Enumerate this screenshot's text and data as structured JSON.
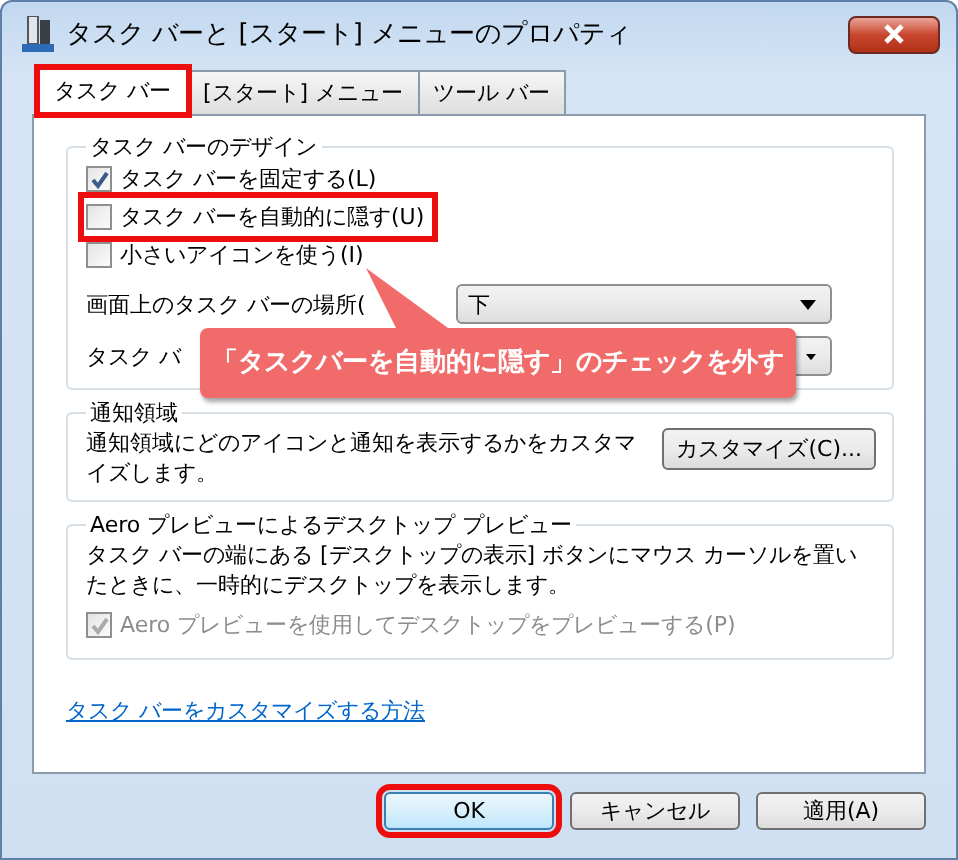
{
  "window": {
    "title": "タスク バーと [スタート] メニューのプロパティ"
  },
  "tabs": [
    {
      "label": "タスク バー",
      "selected": true,
      "highlighted": true
    },
    {
      "label": "[スタート] メニュー",
      "selected": false,
      "highlighted": false
    },
    {
      "label": "ツール バー",
      "selected": false,
      "highlighted": false
    }
  ],
  "design_group": {
    "title": "タスク バーのデザイン",
    "checkboxes": [
      {
        "label": "タスク バーを固定する(L)",
        "checked": true,
        "highlighted": false
      },
      {
        "label": "タスク バーを自動的に隠す(U)",
        "checked": false,
        "highlighted": true
      },
      {
        "label": "小さいアイコンを使う(I)",
        "checked": false,
        "highlighted": false
      }
    ],
    "dropdowns": [
      {
        "label": "画面上のタスク バーの場所(",
        "value": "下"
      },
      {
        "label": "タスク バ"
      }
    ]
  },
  "notification_group": {
    "title": "通知領域",
    "text": "通知領域にどのアイコンと通知を表示するかをカスタマイズします。",
    "button": "カスタマイズ(C)..."
  },
  "aero_group": {
    "title": "Aero プレビューによるデスクトップ プレビュー",
    "text": "タスク バーの端にある [デスクトップの表示] ボタンにマウス カーソルを置いたときに、一時的にデスクトップを表示します。",
    "checkbox": {
      "label": "Aero プレビューを使用してデスクトップをプレビューする(P)",
      "checked": true,
      "disabled": true
    }
  },
  "link": "タスク バーをカスタマイズする方法",
  "buttons": [
    {
      "label": "OK",
      "default": true,
      "highlighted": true
    },
    {
      "label": "キャンセル",
      "default": false,
      "highlighted": false
    },
    {
      "label": "適用(A)",
      "default": false,
      "highlighted": false
    }
  ],
  "callout": {
    "text": "「タスクバーを自動的に隠す」のチェックを外す"
  }
}
